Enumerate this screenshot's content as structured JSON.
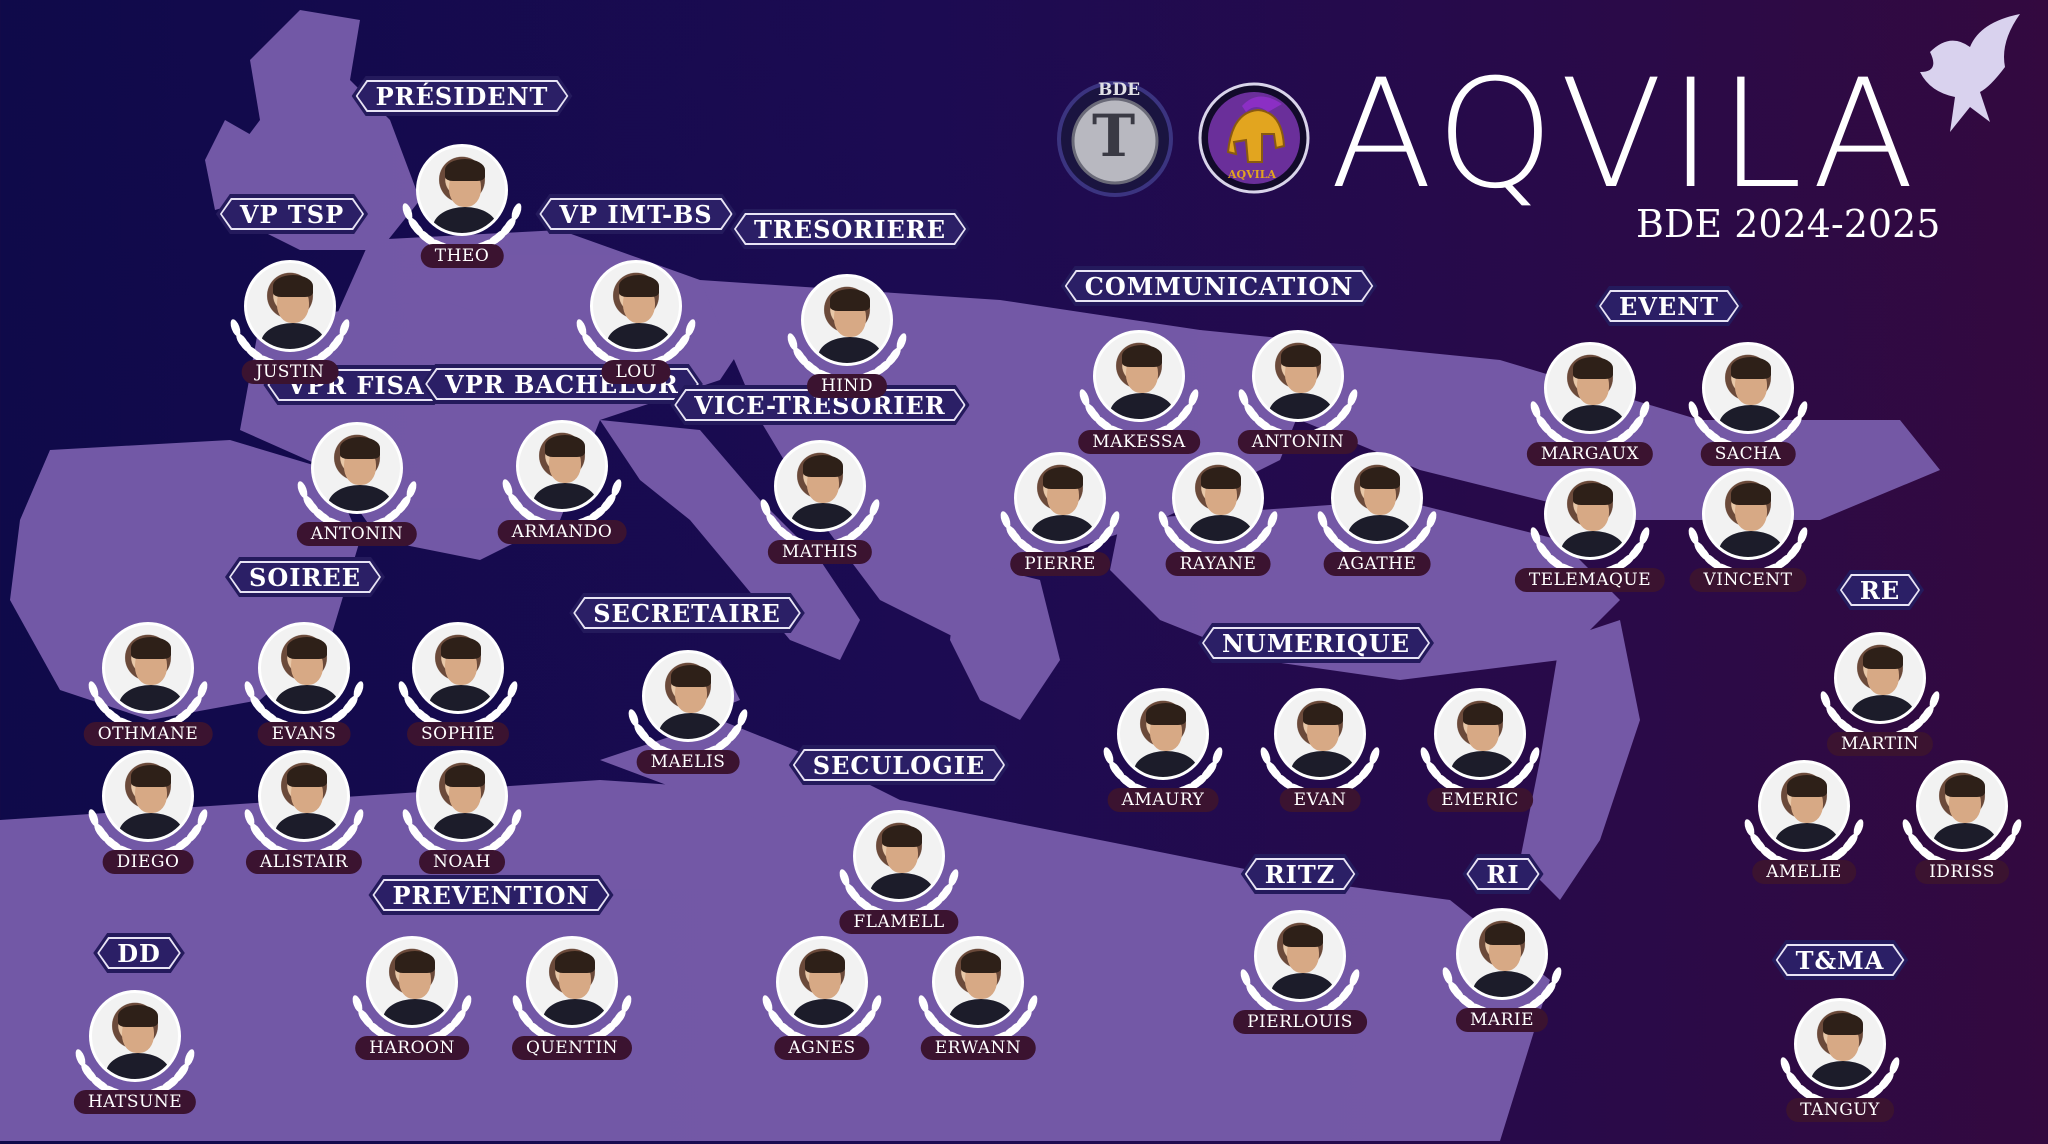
{
  "header": {
    "title": "AQVILA",
    "subtitle": "BDE 2024-2025",
    "logo_bde_label": "BDE",
    "logo_bde_letter": "T",
    "logo_aqvila_label": "AQVILA"
  },
  "colors": {
    "background_left": "#0f0a4a",
    "background_right": "#33093f",
    "map_land": "#7b5fae",
    "label_fill": "#2b1f66",
    "name_fill": "#3b1330",
    "text": "#ffffff"
  },
  "roles": [
    {
      "id": "president",
      "label": "PRÉSIDENT"
    },
    {
      "id": "vp-tsp",
      "label": "VP TSP"
    },
    {
      "id": "vp-imt-bs",
      "label": "VP IMT-BS"
    },
    {
      "id": "tresoriere",
      "label": "TRESORIERE"
    },
    {
      "id": "communication",
      "label": "COMMUNICATION"
    },
    {
      "id": "event",
      "label": "EVENT"
    },
    {
      "id": "vpr-fisa",
      "label": "VPR FISA"
    },
    {
      "id": "vpr-bachelor",
      "label": "VPR BACHELOR"
    },
    {
      "id": "vice-tresorier",
      "label": "VICE-TRESORIER"
    },
    {
      "id": "soiree",
      "label": "SOIREE"
    },
    {
      "id": "secretaire",
      "label": "SECRETAIRE"
    },
    {
      "id": "numerique",
      "label": "NUMERIQUE"
    },
    {
      "id": "re",
      "label": "RE"
    },
    {
      "id": "seculogie",
      "label": "SECULOGIE"
    },
    {
      "id": "prevention",
      "label": "PREVENTION"
    },
    {
      "id": "ritz",
      "label": "RITZ"
    },
    {
      "id": "ri",
      "label": "RI"
    },
    {
      "id": "dd",
      "label": "DD"
    },
    {
      "id": "tma",
      "label": "T&MA"
    }
  ],
  "members": [
    {
      "name": "THEO",
      "role": "president"
    },
    {
      "name": "JUSTIN",
      "role": "vp-tsp"
    },
    {
      "name": "LOU",
      "role": "vp-imt-bs"
    },
    {
      "name": "HIND",
      "role": "tresoriere"
    },
    {
      "name": "MAKESSA",
      "role": "communication"
    },
    {
      "name": "ANTONIN",
      "role": "communication"
    },
    {
      "name": "PIERRE",
      "role": "communication"
    },
    {
      "name": "RAYANE",
      "role": "communication"
    },
    {
      "name": "AGATHE",
      "role": "communication"
    },
    {
      "name": "MARGAUX",
      "role": "event"
    },
    {
      "name": "SACHA",
      "role": "event"
    },
    {
      "name": "TELEMAQUE",
      "role": "event"
    },
    {
      "name": "VINCENT",
      "role": "event"
    },
    {
      "name": "ANTONIN",
      "role": "vpr-fisa"
    },
    {
      "name": "ARMANDO",
      "role": "vpr-bachelor"
    },
    {
      "name": "MATHIS",
      "role": "vice-tresorier"
    },
    {
      "name": "OTHMANE",
      "role": "soiree"
    },
    {
      "name": "EVANS",
      "role": "soiree"
    },
    {
      "name": "SOPHIE",
      "role": "soiree"
    },
    {
      "name": "DIEGO",
      "role": "soiree"
    },
    {
      "name": "ALISTAIR",
      "role": "soiree"
    },
    {
      "name": "NOAH",
      "role": "soiree"
    },
    {
      "name": "MAELIS",
      "role": "secretaire"
    },
    {
      "name": "AMAURY",
      "role": "numerique"
    },
    {
      "name": "EVAN",
      "role": "numerique"
    },
    {
      "name": "EMERIC",
      "role": "numerique"
    },
    {
      "name": "MARTIN",
      "role": "re"
    },
    {
      "name": "AMELIE",
      "role": "re"
    },
    {
      "name": "IDRISS",
      "role": "re"
    },
    {
      "name": "FLAMELL",
      "role": "seculogie"
    },
    {
      "name": "AGNES",
      "role": "seculogie"
    },
    {
      "name": "ERWANN",
      "role": "seculogie"
    },
    {
      "name": "HAROON",
      "role": "prevention"
    },
    {
      "name": "QUENTIN",
      "role": "prevention"
    },
    {
      "name": "PIERLOUIS",
      "role": "ritz"
    },
    {
      "name": "MARIE",
      "role": "ri"
    },
    {
      "name": "HATSUNE",
      "role": "dd"
    },
    {
      "name": "TANGUY",
      "role": "tma"
    }
  ]
}
